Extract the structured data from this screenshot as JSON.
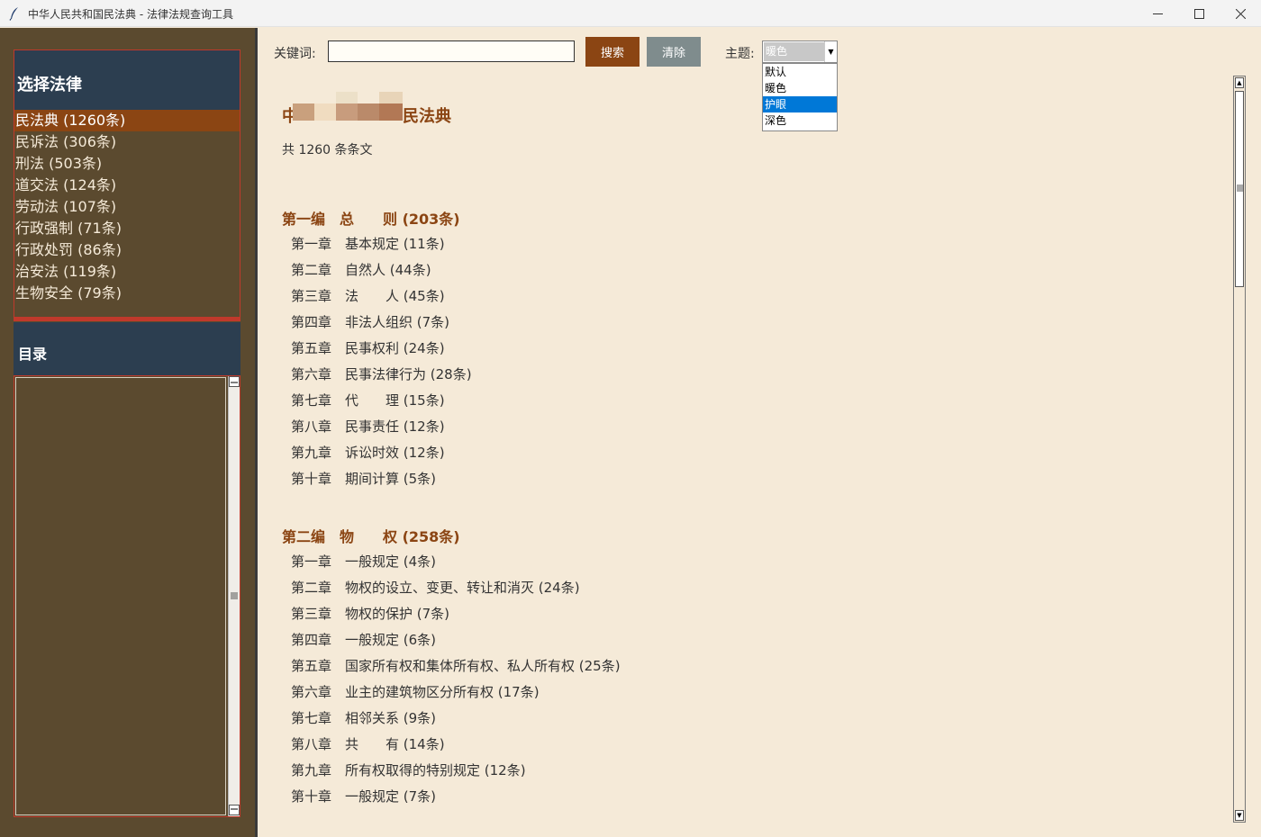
{
  "window": {
    "title": "中华人民共和国民法典 - 法律法规查询工具",
    "minimize": "—",
    "maximize": "☐",
    "close": "✕"
  },
  "sidebar": {
    "law_header": "选择法律",
    "laws": [
      {
        "label": "民法典 (1260条)",
        "selected": true
      },
      {
        "label": "民诉法 (306条)",
        "selected": false
      },
      {
        "label": "刑法 (503条)",
        "selected": false
      },
      {
        "label": "道交法 (124条)",
        "selected": false
      },
      {
        "label": "劳动法 (107条)",
        "selected": false
      },
      {
        "label": "行政强制 (71条)",
        "selected": false
      },
      {
        "label": "行政处罚 (86条)",
        "selected": false
      },
      {
        "label": "治安法 (119条)",
        "selected": false
      },
      {
        "label": "生物安全 (79条)",
        "selected": false
      }
    ],
    "toc_header": "目录"
  },
  "toolbar": {
    "keyword_label": "关键词:",
    "keyword_value": "",
    "search_label": "搜索",
    "clear_label": "清除",
    "theme_label": "主题:",
    "theme_value": "暖色",
    "theme_options": [
      "默认",
      "暖色",
      "护眼",
      "深色"
    ],
    "theme_highlighted": "护眼"
  },
  "document": {
    "title_start": "中",
    "title_end": "民法典",
    "count": "共 1260 条条文",
    "parts": [
      {
        "label": "第一编　总　　则 (203条)",
        "chapters": [
          "第一章　基本规定 (11条)",
          "第二章　自然人 (44条)",
          "第三章　法　　人 (45条)",
          "第四章　非法人组织 (7条)",
          "第五章　民事权利 (24条)",
          "第六章　民事法律行为 (28条)",
          "第七章　代　　理 (15条)",
          "第八章　民事责任 (12条)",
          "第九章　诉讼时效 (12条)",
          "第十章　期间计算 (5条)"
        ]
      },
      {
        "label": "第二编　物　　权 (258条)",
        "chapters": [
          "第一章　一般规定 (4条)",
          "第二章　物权的设立、变更、转让和消灭 (24条)",
          "第三章　物权的保护 (7条)",
          "第四章　一般规定 (6条)",
          "第五章　国家所有权和集体所有权、私人所有权 (25条)",
          "第六章　业主的建筑物区分所有权 (17条)",
          "第七章　相邻关系 (9条)",
          "第八章　共　　有 (14条)",
          "第九章　所有权取得的特别规定 (12条)",
          "第十章　一般规定 (7条)"
        ]
      }
    ]
  },
  "colors": {
    "accent": "#8b4513",
    "panel": "#5b4a2f",
    "header": "#2c3e50",
    "divider": "#c0392b",
    "background": "#f5ead8"
  }
}
